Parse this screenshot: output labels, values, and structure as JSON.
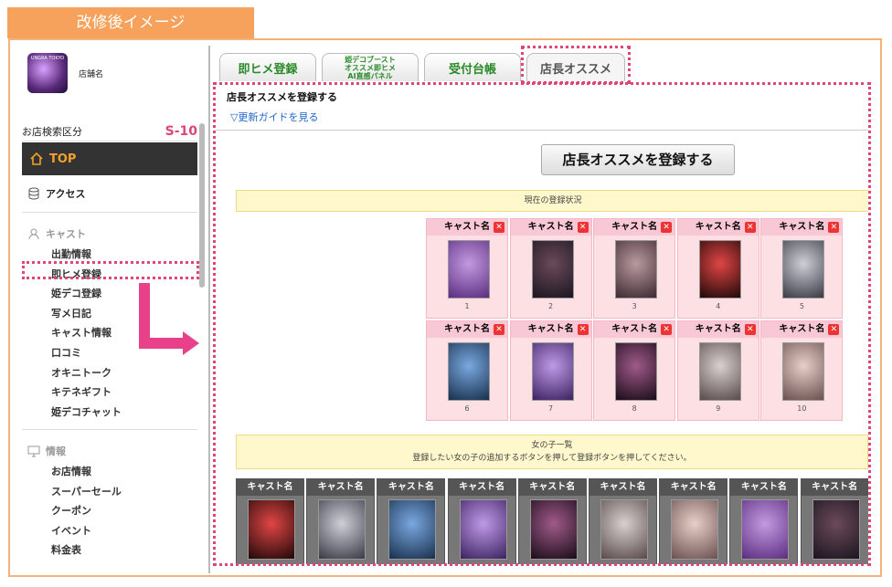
{
  "banner": "改修後イメージ",
  "sidebar": {
    "shop_name": "店舗名",
    "logo_text": "UNGRA TOKYO",
    "search_label": "お店検索区分",
    "search_code": "S-10",
    "top": "TOP",
    "access": "アクセス",
    "cast_header": "キャスト",
    "cast_items": [
      "出勤情報",
      "即ヒメ登録",
      "姫デコ登録",
      "写メ日記",
      "キャスト情報",
      "口コミ",
      "オキニトーク",
      "キテネギフト",
      "姫デコチャット"
    ],
    "info_header": "情報",
    "info_items": [
      "お店情報",
      "スーパーセール",
      "クーポン",
      "イベント",
      "料金表"
    ]
  },
  "tabs": [
    {
      "label": "即ヒメ登録"
    },
    {
      "label": "姫デコブースト\nオススメ即ヒメ\nAI直感パネル"
    },
    {
      "label": "受付台帳"
    },
    {
      "label": "店長オススメ"
    }
  ],
  "main": {
    "title": "店長オススメを登録する",
    "guide": "▽更新ガイドを見る",
    "register_button": "店長オススメを登録する",
    "status_heading": "現在の登録状況",
    "cast_label": "キャスト名",
    "registered": [
      "1",
      "2",
      "3",
      "4",
      "5",
      "6",
      "7",
      "8",
      "9",
      "10"
    ],
    "girls_heading": "女の子一覧",
    "girls_instruction": "登録したい女の子の追加するボタンを押して登録ボタンを押してください。",
    "girls_count": 9
  },
  "colors": {
    "accent": "#e0457a",
    "banner": "#f7a25c",
    "tab_text": "#2a8a2a",
    "status_bg": "#fff8cc",
    "cell_bg": "#fde0e4"
  }
}
